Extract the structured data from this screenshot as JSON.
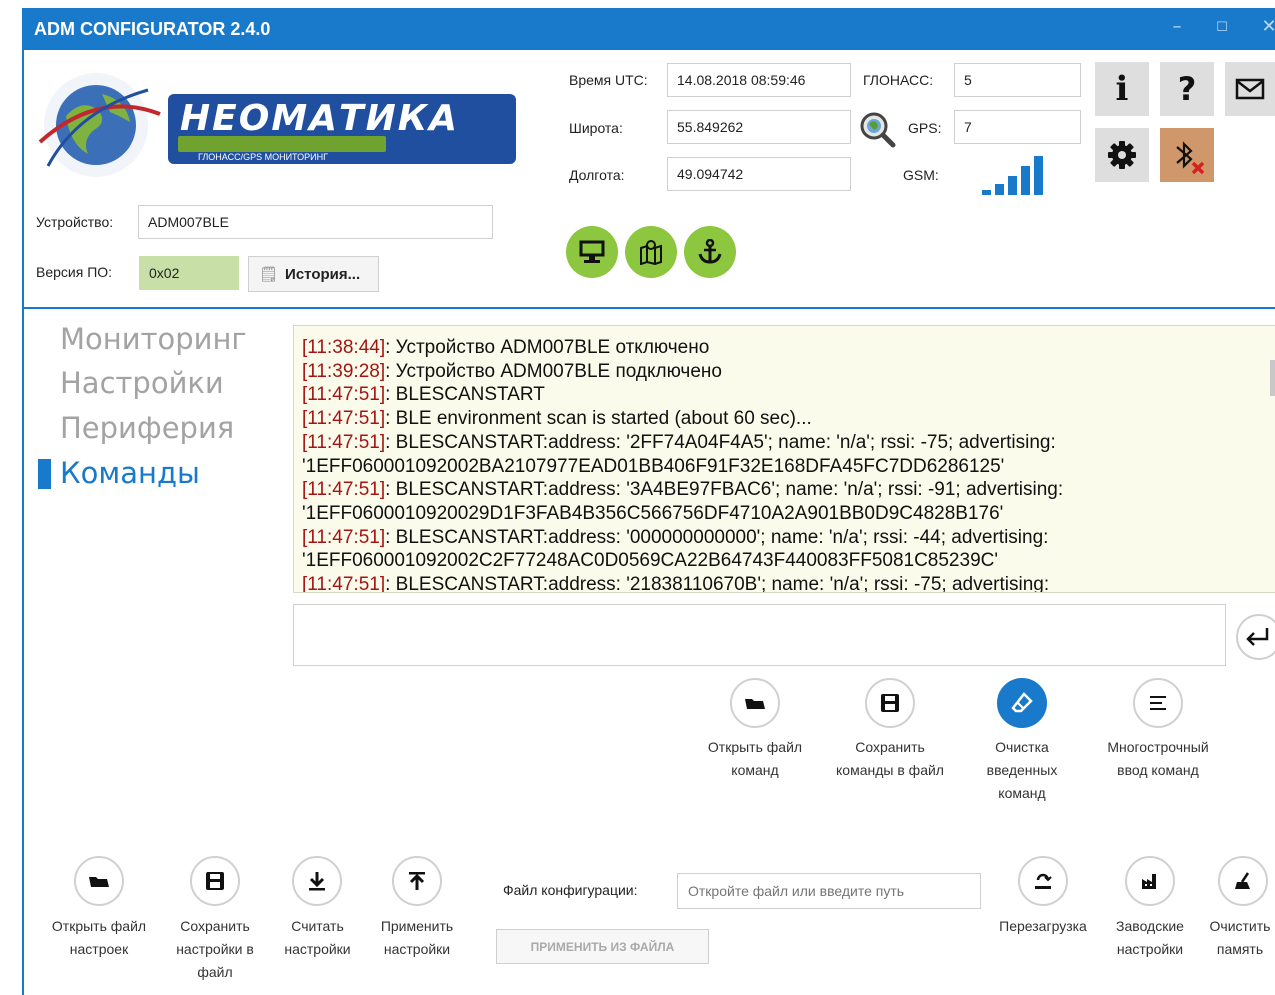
{
  "window": {
    "title": "ADM CONFIGURATOR 2.4.0"
  },
  "colors": {
    "accent": "#1979ca",
    "green": "#8dc63f",
    "bt_bg": "#d0986a",
    "timestamp": "#a31515",
    "console_bg": "#fbfbeb"
  },
  "logo": {
    "brand": "НЕОМАТИКА",
    "tagline": "ГЛОНАСС/GPS МОНИТОРИНГ"
  },
  "device": {
    "device_label": "Устройство:",
    "device_value": "ADM007BLE",
    "firmware_label": "Версия ПО:",
    "firmware_value": "0x02",
    "history_button": "История..."
  },
  "status": {
    "utc_label": "Время UTC:",
    "utc_value": "14.08.2018 08:59:46",
    "lat_label": "Широта:",
    "lat_value": "55.849262",
    "lon_label": "Долгота:",
    "lon_value": "49.094742",
    "glonass_label": "ГЛОНАСС:",
    "glonass_value": "5",
    "gps_label": "GPS:",
    "gps_value": "7",
    "gsm_label": "GSM:",
    "gsm_bars": 5
  },
  "toolbar": {
    "info": "i",
    "help": "?"
  },
  "nav": [
    "Мониторинг",
    "Настройки",
    "Периферия",
    "Команды"
  ],
  "nav_active": "Команды",
  "console": [
    {
      "ts": "[11:38:44]",
      "text": ": Устройство ADM007BLE отключено"
    },
    {
      "ts": "[11:39:28]",
      "text": ": Устройство ADM007BLE подключено"
    },
    {
      "ts": "[11:47:51]",
      "text": ": BLESCANSTART"
    },
    {
      "ts": "[11:47:51]",
      "text": ": BLE environment scan is started (about 60 sec)..."
    },
    {
      "ts": "[11:47:51]",
      "text": ": BLESCANSTART:address: '2FF74A04F4A5'; name: 'n/a'; rssi: -75; advertising:"
    },
    {
      "ts": "",
      "text": "'1EFF060001092002BA2107977EAD01BB406F91F32E168DFA45FC7DD6286125'"
    },
    {
      "ts": "[11:47:51]",
      "text": ": BLESCANSTART:address: '3A4BE97FBAC6'; name: 'n/a'; rssi: -91; advertising:"
    },
    {
      "ts": "",
      "text": "'1EFF0600010920029D1F3FAB4B356C566756DF4710A2A901BB0D9C4828B176'"
    },
    {
      "ts": "[11:47:51]",
      "text": ": BLESCANSTART:address: '000000000000'; name: 'n/a'; rssi: -44; advertising:"
    },
    {
      "ts": "",
      "text": "'1EFF060001092002C2F77248AC0D0569CA22B64743F440083FF5081C85239C'"
    },
    {
      "ts": "[11:47:51]",
      "text": ": BLESCANSTART:address: '21838110670B'; name: 'n/a'; rssi: -75; advertising:"
    }
  ],
  "command_input": {
    "value": ""
  },
  "cmd_actions": [
    {
      "label_lines": [
        "Открыть файл",
        "команд"
      ]
    },
    {
      "label_lines": [
        "Сохранить",
        "команды в файл"
      ]
    },
    {
      "label_lines": [
        "Очистка",
        "введенных",
        "команд"
      ]
    },
    {
      "label_lines": [
        "Многострочный",
        "ввод команд"
      ]
    }
  ],
  "bottom_actions": [
    {
      "label_lines": [
        "Открыть файл",
        "настроек"
      ]
    },
    {
      "label_lines": [
        "Сохранить",
        "настройки в",
        "файл"
      ]
    },
    {
      "label_lines": [
        "Считать",
        "настройки"
      ]
    },
    {
      "label_lines": [
        "Применить",
        "настройки"
      ]
    }
  ],
  "config_file": {
    "label": "Файл конфигурации:",
    "placeholder": "Откройте файл или введите путь",
    "apply_button": "ПРИМЕНИТЬ ИЗ ФАЙЛА"
  },
  "device_actions": [
    {
      "label_lines": [
        "Перезагрузка"
      ]
    },
    {
      "label_lines": [
        "Заводские",
        "настройки"
      ]
    },
    {
      "label_lines": [
        "Очистить",
        "память"
      ]
    }
  ]
}
